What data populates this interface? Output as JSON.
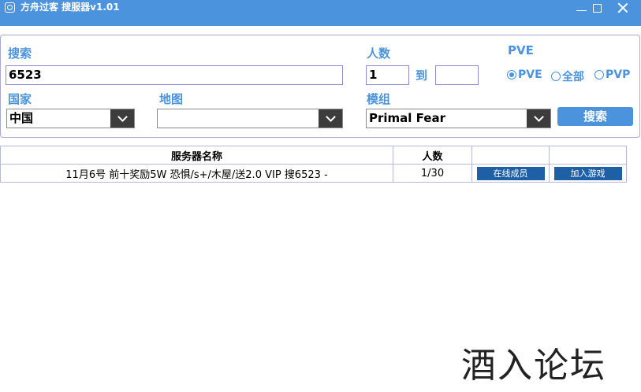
{
  "window": {
    "title": "方舟过客 搜服器v1.01"
  },
  "search": {
    "label": "搜索",
    "value": "6523"
  },
  "players": {
    "label": "人数",
    "min": "1",
    "to_label": "到",
    "max": ""
  },
  "mode": {
    "label": "PVE",
    "options": [
      "PVE",
      "全部",
      "PVP"
    ],
    "selected": "PVE"
  },
  "country": {
    "label": "国家",
    "value": "中国"
  },
  "map": {
    "label": "地图",
    "value": ""
  },
  "mod": {
    "label": "模组",
    "value": "Primal Fear"
  },
  "search_button": "搜索",
  "table": {
    "headers": [
      "服务器名称",
      "人数",
      "",
      ""
    ],
    "rows": [
      {
        "name": "11月6号 前十奖励5W 恐惧/s+/木屋/送2.0 VIP 搜6523 -",
        "players": "1/30",
        "members_btn": "在线成员",
        "join_btn": "加入游戏"
      }
    ]
  },
  "watermark": "酒入论坛",
  "colors": {
    "accent": "#4b93dd",
    "row_button": "#1f5fa6"
  }
}
